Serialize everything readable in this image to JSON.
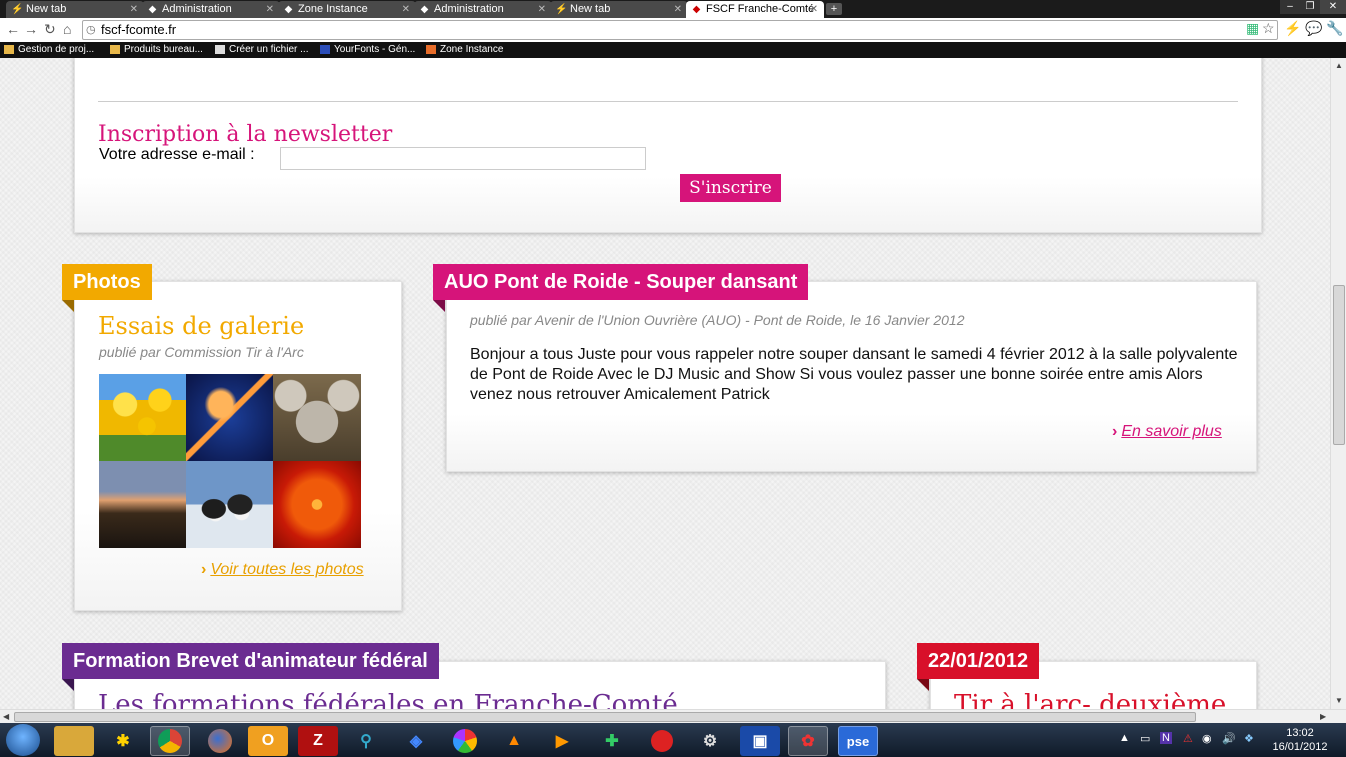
{
  "browser": {
    "tabs": [
      {
        "label": "New tab"
      },
      {
        "label": "Administration"
      },
      {
        "label": "Zone Instance"
      },
      {
        "label": "Administration"
      },
      {
        "label": "New tab"
      },
      {
        "label": "FSCF Franche-Comté"
      }
    ],
    "url": "fscf-fcomte.fr",
    "bookmarks": [
      {
        "label": "Gestion de proj..."
      },
      {
        "label": "Produits bureau..."
      },
      {
        "label": "Créer un fichier ..."
      },
      {
        "label": "YourFonts - Gén..."
      },
      {
        "label": "Zone Instance"
      }
    ]
  },
  "newsletter": {
    "title": "Inscription à la newsletter",
    "email_label": "Votre adresse e-mail :",
    "email_value": "",
    "submit_label": "S'inscrire"
  },
  "photos": {
    "ribbon": "Photos",
    "title": "Essais de galerie",
    "byline": "publié par Commission Tir à l'Arc",
    "thumbnails": [
      "tulips",
      "jellyfish",
      "koala",
      "lighthouse",
      "penguins",
      "chrysanthemum"
    ],
    "more_link": "Voir toutes les photos"
  },
  "article": {
    "ribbon": "AUO Pont de Roide - Souper dansant",
    "byline": "publié par Avenir de l'Union Ouvrière (AUO) - Pont de Roide, le 16 Janvier 2012",
    "body": "Bonjour a tous Juste pour vous rappeler notre souper dansant le samedi 4 février 2012 à la salle polyvalente de Pont de Roide Avec le DJ Music and Show Si vous voulez passer une bonne soirée entre amis Alors venez nous retrouver Amicalement Patrick",
    "more_link": "En savoir plus"
  },
  "formation": {
    "ribbon": "Formation Brevet d'animateur fédéral",
    "title": "Les formations fédérales en Franche-Comté"
  },
  "event": {
    "ribbon": "22/01/2012",
    "title": "Tir à l'arc- deuxième"
  },
  "colors": {
    "pink": "#d6147a",
    "orange": "#f2a900",
    "purple": "#6b2c91",
    "red": "#d8102a"
  },
  "taskbar": {
    "time": "13:02",
    "date": "16/01/2012"
  }
}
